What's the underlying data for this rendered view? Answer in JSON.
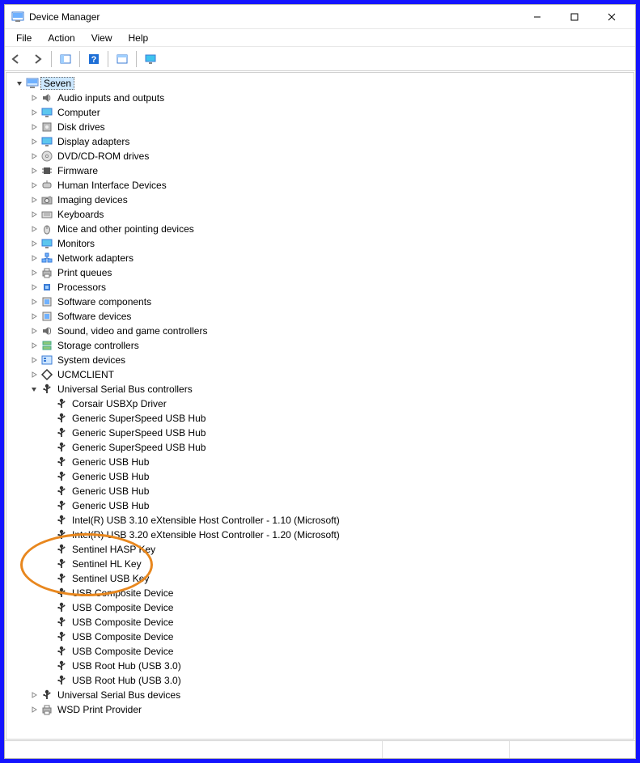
{
  "window": {
    "title": "Device Manager",
    "controls": {
      "min": "—",
      "max": "▢",
      "close": "✕"
    }
  },
  "menu": {
    "file": "File",
    "action": "Action",
    "view": "View",
    "help": "Help"
  },
  "toolbar": {
    "back_icon": "back-arrow",
    "fwd_icon": "forward-arrow",
    "pane_icon": "show-pane",
    "help_icon": "help",
    "scan_icon": "scan-hw",
    "monitor_icon": "monitor"
  },
  "tree": {
    "root": {
      "label": "Seven",
      "icon": "computer",
      "expanded": true,
      "selected": true,
      "children": [
        {
          "label": "Audio inputs and outputs",
          "icon": "speaker",
          "expandable": true
        },
        {
          "label": "Computer",
          "icon": "monitor",
          "expandable": true
        },
        {
          "label": "Disk drives",
          "icon": "disk",
          "expandable": true
        },
        {
          "label": "Display adapters",
          "icon": "monitor",
          "expandable": true
        },
        {
          "label": "DVD/CD-ROM drives",
          "icon": "disc",
          "expandable": true
        },
        {
          "label": "Firmware",
          "icon": "chip",
          "expandable": true
        },
        {
          "label": "Human Interface Devices",
          "icon": "hid",
          "expandable": true
        },
        {
          "label": "Imaging devices",
          "icon": "camera",
          "expandable": true
        },
        {
          "label": "Keyboards",
          "icon": "keyboard",
          "expandable": true
        },
        {
          "label": "Mice and other pointing devices",
          "icon": "mouse",
          "expandable": true
        },
        {
          "label": "Monitors",
          "icon": "monitor",
          "expandable": true
        },
        {
          "label": "Network adapters",
          "icon": "network",
          "expandable": true
        },
        {
          "label": "Print queues",
          "icon": "printer",
          "expandable": true
        },
        {
          "label": "Processors",
          "icon": "cpu",
          "expandable": true
        },
        {
          "label": "Software components",
          "icon": "sw",
          "expandable": true
        },
        {
          "label": "Software devices",
          "icon": "sw",
          "expandable": true
        },
        {
          "label": "Sound, video and game controllers",
          "icon": "sound",
          "expandable": true
        },
        {
          "label": "Storage controllers",
          "icon": "storage",
          "expandable": true
        },
        {
          "label": "System devices",
          "icon": "system",
          "expandable": true
        },
        {
          "label": "UCMCLIENT",
          "icon": "diamond",
          "expandable": true
        },
        {
          "label": "Universal Serial Bus controllers",
          "icon": "usb",
          "expandable": true,
          "expanded": true,
          "children": [
            {
              "label": "Corsair USBXp Driver",
              "icon": "usb"
            },
            {
              "label": "Generic SuperSpeed USB Hub",
              "icon": "usb"
            },
            {
              "label": "Generic SuperSpeed USB Hub",
              "icon": "usb"
            },
            {
              "label": "Generic SuperSpeed USB Hub",
              "icon": "usb"
            },
            {
              "label": "Generic USB Hub",
              "icon": "usb"
            },
            {
              "label": "Generic USB Hub",
              "icon": "usb"
            },
            {
              "label": "Generic USB Hub",
              "icon": "usb"
            },
            {
              "label": "Generic USB Hub",
              "icon": "usb"
            },
            {
              "label": "Intel(R) USB 3.10 eXtensible Host Controller - 1.10 (Microsoft)",
              "icon": "usb"
            },
            {
              "label": "Intel(R) USB 3.20 eXtensible Host Controller - 1.20 (Microsoft)",
              "icon": "usb"
            },
            {
              "label": "Sentinel HASP Key",
              "icon": "usb"
            },
            {
              "label": "Sentinel HL Key",
              "icon": "usb"
            },
            {
              "label": "Sentinel USB Key",
              "icon": "usb"
            },
            {
              "label": "USB Composite Device",
              "icon": "usb"
            },
            {
              "label": "USB Composite Device",
              "icon": "usb"
            },
            {
              "label": "USB Composite Device",
              "icon": "usb"
            },
            {
              "label": "USB Composite Device",
              "icon": "usb"
            },
            {
              "label": "USB Composite Device",
              "icon": "usb"
            },
            {
              "label": "USB Root Hub (USB 3.0)",
              "icon": "usb"
            },
            {
              "label": "USB Root Hub (USB 3.0)",
              "icon": "usb"
            }
          ]
        },
        {
          "label": "Universal Serial Bus devices",
          "icon": "usb",
          "expandable": true
        },
        {
          "label": "WSD Print Provider",
          "icon": "printer",
          "expandable": true
        }
      ]
    }
  },
  "annotation": {
    "circle_targets": [
      "Sentinel HASP Key",
      "Sentinel HL Key",
      "Sentinel USB Key"
    ],
    "color": "#e8871e"
  }
}
